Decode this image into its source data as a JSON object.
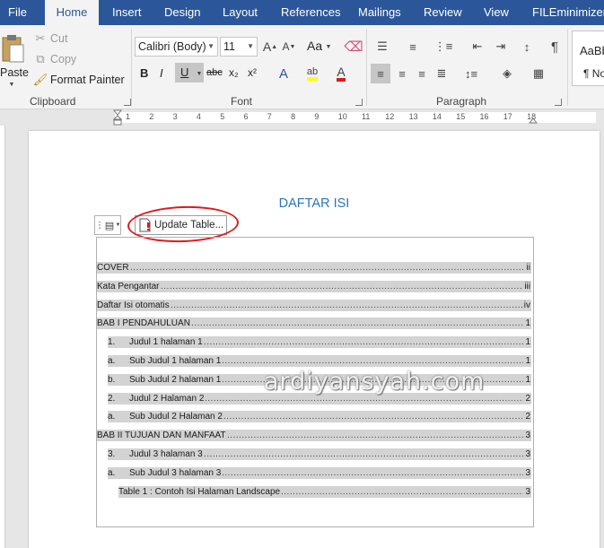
{
  "tabs": [
    "File",
    "Home",
    "Insert",
    "Design",
    "Layout",
    "References",
    "Mailings",
    "Review",
    "View",
    "FILEminimizer"
  ],
  "active_tab": "Home",
  "clipboard": {
    "paste_label": "Paste",
    "cut_label": "Cut",
    "copy_label": "Copy",
    "format_painter_label": "Format Painter",
    "group_label": "Clipboard"
  },
  "font": {
    "font_name": "Calibri (Body)",
    "font_size": "11",
    "change_case_label": "Aa",
    "bold": "B",
    "italic": "I",
    "underline": "U",
    "strikethrough": "abc",
    "subscript": "x₂",
    "superscript": "x²",
    "group_label": "Font"
  },
  "paragraph": {
    "group_label": "Paragraph"
  },
  "styles": {
    "preview": "AaBb",
    "normal_label": "¶ No"
  },
  "ruler": {
    "numbers": [
      "1",
      "2",
      "3",
      "4",
      "5",
      "6",
      "7",
      "8",
      "9",
      "10",
      "11",
      "12",
      "13",
      "14",
      "15",
      "16",
      "17",
      "18"
    ]
  },
  "document": {
    "toc_title": "DAFTAR ISI",
    "update_table_label": "Update Table...",
    "watermark": "ardiyansyah.com",
    "toc_entries": [
      {
        "num": "",
        "label": "COVER",
        "page": "ii"
      },
      {
        "num": "",
        "label": "Kata Pengantar",
        "page": "iii"
      },
      {
        "num": "",
        "label": "Daftar Isi otomatis",
        "page": "iv"
      },
      {
        "num": "",
        "label": "BAB I PENDAHULUAN",
        "page": "1"
      },
      {
        "num": "1.",
        "label": "Judul 1 halaman 1",
        "page": "1"
      },
      {
        "num": "a.",
        "label": "Sub Judul 1 halaman 1",
        "page": "1"
      },
      {
        "num": "b.",
        "label": "Sub Judul 2 halaman 1",
        "page": "1"
      },
      {
        "num": "2.",
        "label": "Judul 2 Halaman 2",
        "page": "2"
      },
      {
        "num": "a.",
        "label": "Sub Judul 2 Halaman 2",
        "page": "2"
      },
      {
        "num": "",
        "label": "BAB II TUJUAN DAN MANFAAT",
        "page": "3"
      },
      {
        "num": "3.",
        "label": "Judul 3 halaman 3",
        "page": "3"
      },
      {
        "num": "a.",
        "label": "Sub Judul 3 halaman 3",
        "page": "3"
      },
      {
        "num": "",
        "label": "Table 1 : Contoh Isi Halaman Landscape",
        "page": "3"
      }
    ]
  },
  "colors": {
    "tab_bar": "#2b579a",
    "heading": "#2e74b5",
    "highlight": "#d3d3d3",
    "annotation": "#e0181b"
  }
}
